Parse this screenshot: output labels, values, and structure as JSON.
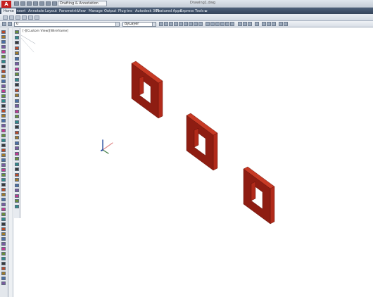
{
  "window": {
    "app_logo": "A",
    "document_title": "Drawing1.dwg",
    "workspace_field": "Drafting & Annotation"
  },
  "ribbon": {
    "tabs": [
      {
        "label": "Home",
        "active": true
      },
      {
        "label": "Insert"
      },
      {
        "label": "Annotate"
      },
      {
        "label": "Layout"
      },
      {
        "label": "Parametric"
      },
      {
        "label": "View"
      },
      {
        "label": "Manage"
      },
      {
        "label": "Output"
      },
      {
        "label": "Plug-ins"
      },
      {
        "label": "Autodesk 360"
      },
      {
        "label": "Featured Apps"
      },
      {
        "label": "Express Tools"
      }
    ]
  },
  "toolbar": {
    "layer_combo": "0",
    "color_combo": "ByLayer"
  },
  "viewport": {
    "label": "[-][Custom View][Wireframe]"
  },
  "scene": {
    "frame_color": "#8e1d12",
    "frame_side_color": "#b12a1a",
    "frame_top_color": "#c73a25",
    "ucs_x_color": "#e08c8c",
    "ucs_y_color": "#3d7a3d",
    "ucs_z_color": "#2a4fa0",
    "frame_count": 3
  }
}
